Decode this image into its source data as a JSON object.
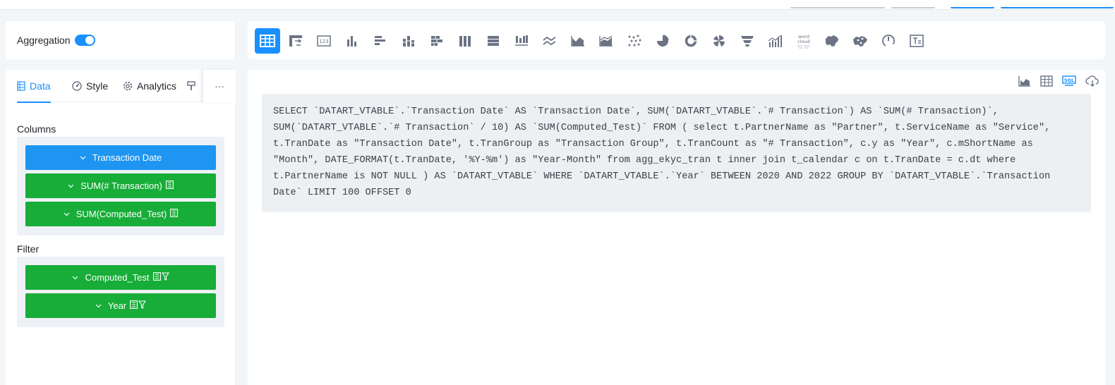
{
  "aggregation": {
    "label": "Aggregation",
    "enabled": true
  },
  "chart_types": [
    {
      "icon": "table-icon",
      "active": true
    },
    {
      "icon": "pivot-sheet-icon",
      "active": false
    },
    {
      "icon": "score-icon",
      "active": false
    },
    {
      "icon": "cluster-column-icon",
      "active": false
    },
    {
      "icon": "cluster-bar-icon",
      "active": false
    },
    {
      "icon": "stack-column-icon",
      "active": false
    },
    {
      "icon": "stack-bar-icon",
      "active": false
    },
    {
      "icon": "percentage-column-icon",
      "active": false
    },
    {
      "icon": "percentage-bar-icon",
      "active": false
    },
    {
      "icon": "waterfall-icon",
      "active": false
    },
    {
      "icon": "line-icon",
      "active": false
    },
    {
      "icon": "area-icon",
      "active": false
    },
    {
      "icon": "stack-area-icon",
      "active": false
    },
    {
      "icon": "scatter-icon",
      "active": false
    },
    {
      "icon": "pie-icon",
      "active": false
    },
    {
      "icon": "doughnut-icon",
      "active": false
    },
    {
      "icon": "rose-icon",
      "active": false
    },
    {
      "icon": "funnel-icon",
      "active": false
    },
    {
      "icon": "double-y-icon",
      "active": false
    },
    {
      "icon": "word-cloud-icon",
      "active": false
    },
    {
      "icon": "map-icon",
      "active": false
    },
    {
      "icon": "scatter-map-icon",
      "active": false
    },
    {
      "icon": "gauge-icon",
      "active": false
    },
    {
      "icon": "rich-text-icon",
      "active": false
    }
  ],
  "word_cloud_label": "word cloud",
  "tabs": [
    {
      "label": "Data",
      "icon": "database-icon",
      "active": true
    },
    {
      "label": "Style",
      "icon": "dashboard-icon",
      "active": false
    },
    {
      "label": "Analytics",
      "icon": "gear-icon",
      "active": false
    }
  ],
  "tab_more": "···",
  "columns": {
    "title": "Columns",
    "items": [
      {
        "label": "Transaction Date",
        "color": "#1e95f0",
        "suffix_icons": []
      },
      {
        "label": "SUM(# Transaction)",
        "color": "#17ad38",
        "suffix_icons": [
          "sum-icon"
        ]
      },
      {
        "label": "SUM(Computed_Test)",
        "color": "#17ad38",
        "suffix_icons": [
          "sum-icon"
        ]
      }
    ]
  },
  "filter": {
    "title": "Filter",
    "items": [
      {
        "label": "Computed_Test",
        "color": "#17ad38",
        "suffix_icons": [
          "sum-icon",
          "filter-icon"
        ]
      },
      {
        "label": "Year",
        "color": "#17ad38",
        "suffix_icons": [
          "sum-icon",
          "filter-icon"
        ]
      }
    ]
  },
  "view_modes": [
    "chart-view-icon",
    "table-view-icon",
    "sql-view-icon",
    "download-icon"
  ],
  "sql_label": "SQL",
  "sql": "SELECT `DATART_VTABLE`.`Transaction Date` AS `Transaction Date`, SUM(`DATART_VTABLE`.`# Transaction`) AS `SUM(# Transaction)`, SUM(`DATART_VTABLE`.`# Transaction` / 10) AS `SUM(Computed_Test)` FROM ( select t.PartnerName as \"Partner\", t.ServiceName as \"Service\", t.TranDate as \"Transaction Date\", t.TranGroup as \"Transaction Group\", t.TranCount as \"# Transaction\", c.y as \"Year\", c.mShortName as \"Month\", DATE_FORMAT(t.TranDate, '%Y-%m') as \"Year-Month\" from agg_ekyc_tran t inner join t_calendar c on t.TranDate = c.dt where t.PartnerName is NOT NULL ) AS `DATART_VTABLE` WHERE `DATART_VTABLE`.`Year` BETWEEN 2020 AND 2022 GROUP BY `DATART_VTABLE`.`Transaction Date` LIMIT 100 OFFSET 0",
  "colors": {
    "primary": "#1890ff",
    "field_blue": "#1e95f0",
    "field_green": "#17ad38",
    "icon_gray": "#6b7385",
    "sql_bg": "#edf0f3"
  }
}
